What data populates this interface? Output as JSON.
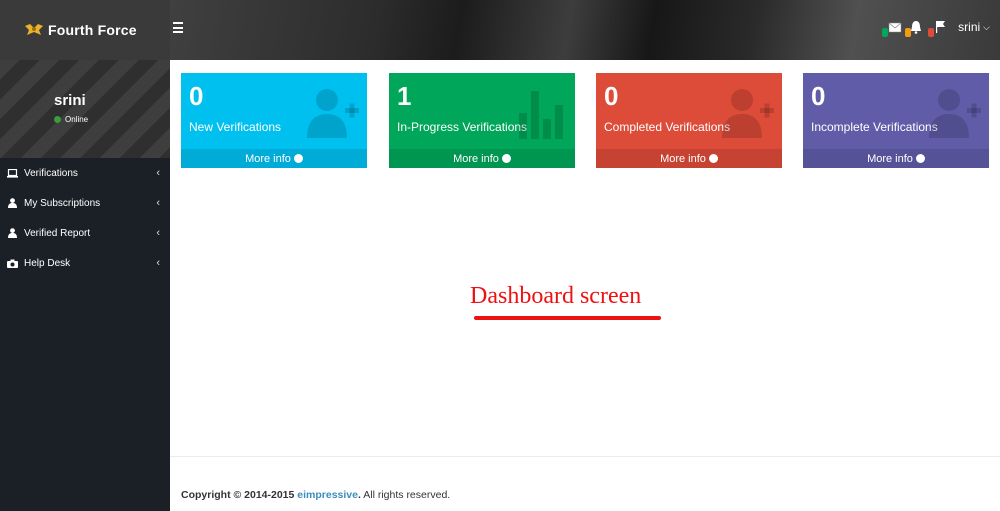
{
  "app": {
    "brand_name": "Fourth Force"
  },
  "header": {
    "user_name": "srini",
    "notifications": [
      {
        "icon": "envelope-icon",
        "color": "#00a65a"
      },
      {
        "icon": "bell-icon",
        "color": "#f39c12"
      },
      {
        "icon": "flag-icon",
        "color": "#dd4b39"
      }
    ]
  },
  "sidebar": {
    "user_name": "srini",
    "status": "Online",
    "items": [
      {
        "label": "Verifications",
        "icon": "laptop-icon"
      },
      {
        "label": "My Subscriptions",
        "icon": "user-icon"
      },
      {
        "label": "Verified Report",
        "icon": "user-icon"
      },
      {
        "label": "Help Desk",
        "icon": "camera-icon"
      }
    ]
  },
  "cards": [
    {
      "count": "0",
      "label": "New Verifications",
      "footer": "More info",
      "icon": "user-add-icon",
      "color": "#00c0ef"
    },
    {
      "count": "1",
      "label": "In-Progress Verifications",
      "footer": "More info",
      "icon": "bar-chart-icon",
      "color": "#00a65a"
    },
    {
      "count": "0",
      "label": "Completed Verifications",
      "footer": "More info",
      "icon": "user-add-icon",
      "color": "#dd4b39"
    },
    {
      "count": "0",
      "label": "Incomplete Verifications",
      "footer": "More info",
      "icon": "user-add-icon",
      "color": "#605ca8"
    }
  ],
  "annotation": {
    "text": "Dashboard screen",
    "color": "#ee1111"
  },
  "footer": {
    "copyright_prefix": "Copyright © 2014-2015 ",
    "company": "eimpressive",
    "period": ".",
    "suffix": " All rights reserved."
  }
}
